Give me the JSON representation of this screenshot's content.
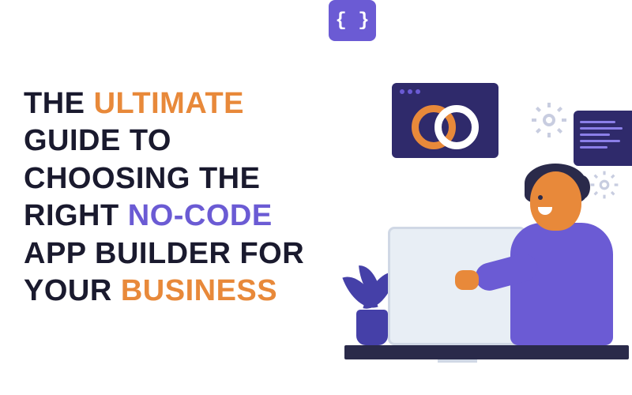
{
  "headline": {
    "parts": [
      {
        "text": "THE ",
        "color": "dark"
      },
      {
        "text": "ULTIMATE",
        "color": "orange"
      },
      {
        "text": " GUIDE TO CHOOSING THE RIGHT ",
        "color": "dark"
      },
      {
        "text": "NO-CODE",
        "color": "purple"
      },
      {
        "text": " APP BUILDER FOR YOUR ",
        "color": "dark"
      },
      {
        "text": "BUSINESS",
        "color": "orange"
      }
    ]
  },
  "braces_panel": {
    "symbol": "{ }"
  },
  "colors": {
    "dark": "#1a1a2e",
    "orange": "#e8893a",
    "purple": "#6b5bd4",
    "navy": "#2f2a6b"
  },
  "icons": {
    "infinity": "infinity-icon",
    "braces": "braces-icon",
    "gear": "gear-icon",
    "code": "code-lines-icon",
    "plant": "plant-icon",
    "person": "developer-avatar"
  }
}
